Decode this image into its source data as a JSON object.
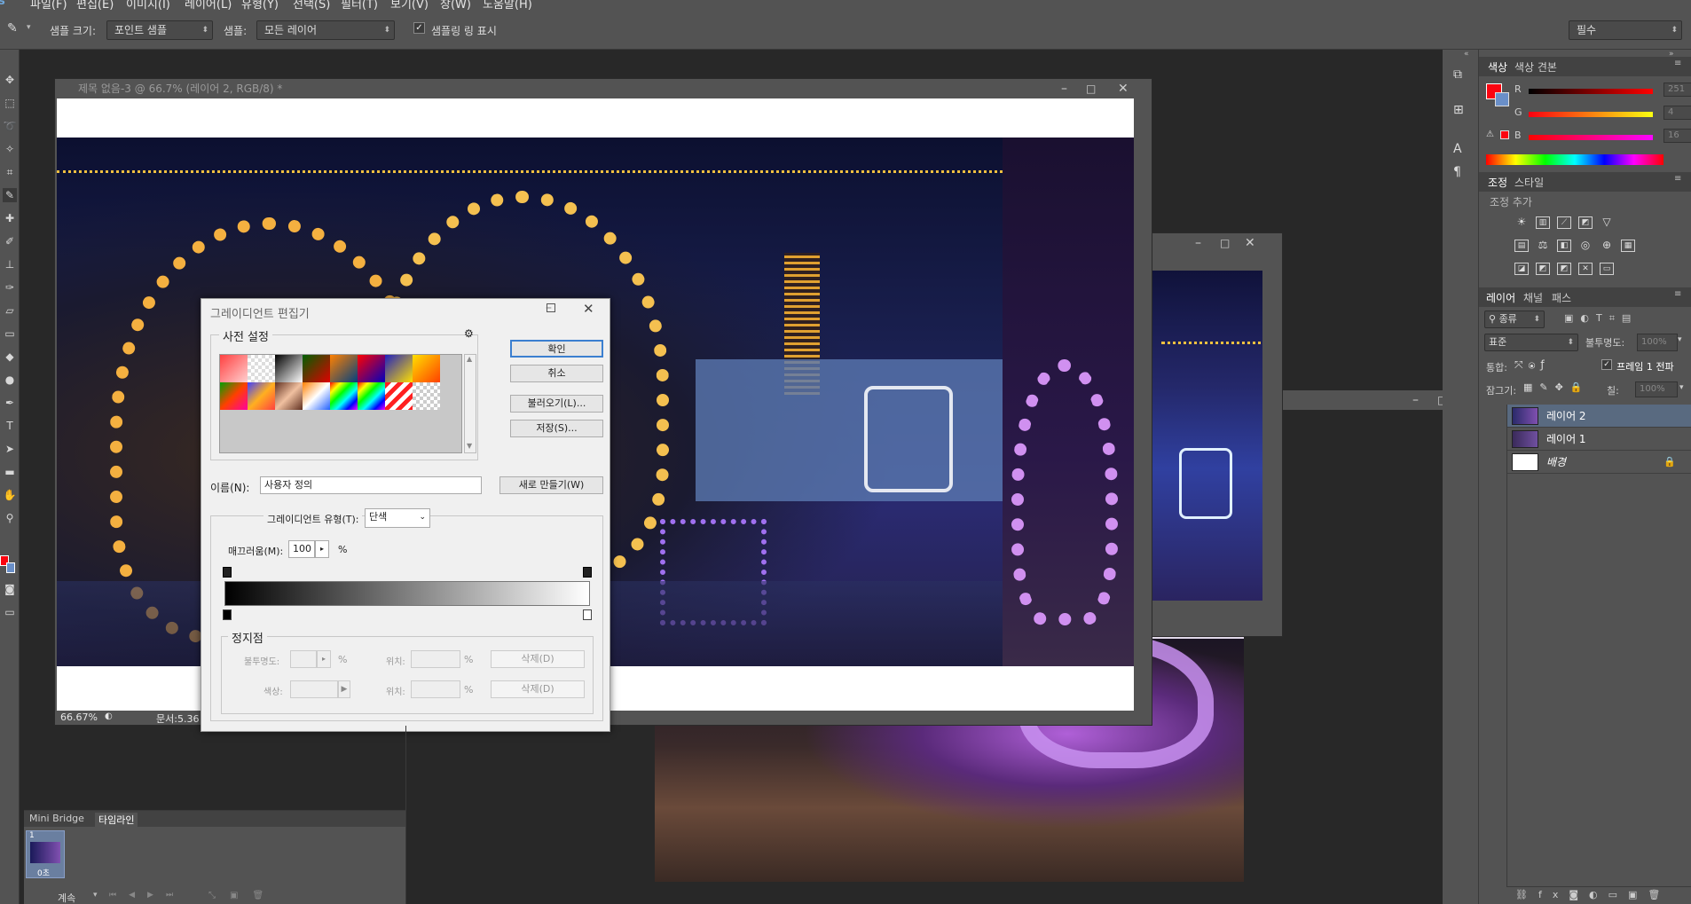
{
  "menu": [
    "파일(F)",
    "편집(E)",
    "이미지(I)",
    "레이어(L)",
    "유형(Y)",
    "선택(S)",
    "필터(T)",
    "보기(V)",
    "창(W)",
    "도움말(H)"
  ],
  "options": {
    "sample_size_label": "샘플 크기:",
    "sample_size_value": "포인트 샘플",
    "sample_label": "샘플:",
    "sample_value": "모든 레이어",
    "show_ring_label": "샘플링 링 표시",
    "workspace": "필수"
  },
  "doc1": {
    "title": "제목 없음-3 @ 66.7% (레이어 2, RGB/8) *",
    "zoom": "66.67%",
    "doc_size": "문서:5.36"
  },
  "gradient_editor": {
    "title": "그레이디언트 편집기",
    "presets_label": "사전 설정",
    "ok": "확인",
    "cancel": "취소",
    "load": "불러오기(L)...",
    "save": "저장(S)...",
    "name_label": "이름(N):",
    "name_value": "사용자 정의",
    "new_button": "새로 만들기(W)",
    "type_label": "그레이디언트 유형(T):",
    "type_value": "단색",
    "smooth_label": "매끄러움(M):",
    "smooth_value": "100",
    "percent": "%",
    "stops_label": "정지점",
    "opacity_label": "불투명도:",
    "color_label": "색상:",
    "location_label": "위치:",
    "delete": "삭제(D)"
  },
  "color_panel": {
    "tabs": [
      "색상",
      "색상 견본"
    ],
    "r_label": "R",
    "g_label": "G",
    "b_label": "B",
    "r": "251",
    "g": "4",
    "b": "16",
    "fg_color": "#fb0410",
    "bg_color": "#6a8fc8"
  },
  "adjust_panel": {
    "tabs": [
      "조정",
      "스타일"
    ],
    "add_label": "조정 추가"
  },
  "layers_panel": {
    "tabs": [
      "레이어",
      "채널",
      "패스"
    ],
    "filter_label": "종류",
    "blend_mode": "표준",
    "opacity_label": "불투명도:",
    "opacity_value": "100%",
    "unify_label": "통합:",
    "propagate_label": "프레임 1 전파",
    "lock_label": "잠그기:",
    "fill_label": "칠:",
    "fill_value": "100%",
    "layers": [
      {
        "name": "레이어 2",
        "selected": true
      },
      {
        "name": "레이어 1",
        "selected": false
      },
      {
        "name": "배경",
        "selected": false
      }
    ]
  },
  "timeline": {
    "tabs": [
      "Mini Bridge",
      "타임라인"
    ],
    "frame_number": "1",
    "frame_delay": "0초",
    "loop": "계속"
  },
  "colors": {
    "panel": "#535353",
    "workspace": "#282828",
    "accent": "#3b7fd0"
  }
}
